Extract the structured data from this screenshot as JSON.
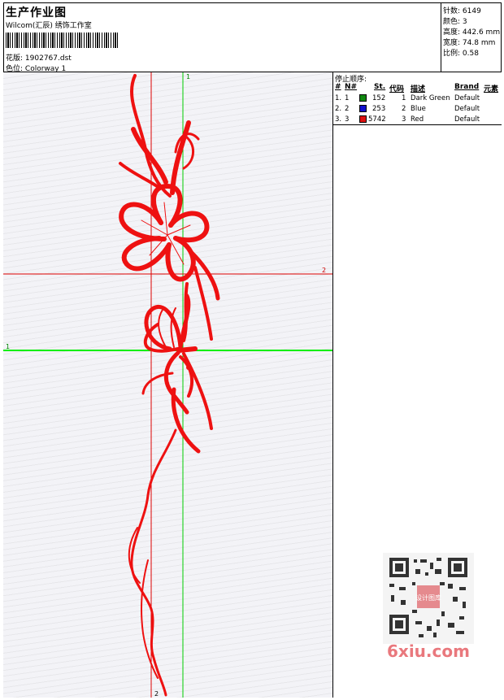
{
  "header": {
    "title": "生产作业图",
    "studio": "Wilcom(汇辰) 绣饰工作室",
    "design_file_label": "花版:",
    "design_file": "1902767.dst",
    "colorway_label": "色位:",
    "colorway": "Colorway 1"
  },
  "stats": {
    "stitches_label": "针数:",
    "stitches": "6149",
    "colors_label": "颜色:",
    "colors": "3",
    "height_label": "高度:",
    "height": "442.6 mm",
    "width_label": "宽度:",
    "width": "74.8 mm",
    "scale_label": "比例:",
    "scale": "0.58"
  },
  "design": {
    "markers": {
      "v_green": "1",
      "v_red": "2",
      "h_red": "2",
      "h_green": "1"
    },
    "thread_color": "#ee1111",
    "guide_green": "#00cc00",
    "guide_red": "#dd0000"
  },
  "stop_sequence": {
    "title": "停止顺序:",
    "headers": {
      "num": "#",
      "needle": "N#",
      "st": "St.",
      "code": "代码",
      "desc": "描述",
      "brand": "Brand",
      "element": "元素"
    },
    "rows": [
      {
        "num": "1.",
        "needle": "1",
        "color": "#118811",
        "st": "152",
        "code": "1",
        "desc": "Dark Green",
        "brand": "Default"
      },
      {
        "num": "2.",
        "needle": "2",
        "color": "#1111cc",
        "st": "253",
        "code": "2",
        "desc": "Blue",
        "brand": "Default"
      },
      {
        "num": "3.",
        "needle": "3",
        "color": "#dd1111",
        "st": "5742",
        "code": "3",
        "desc": "Red",
        "brand": "Default"
      }
    ]
  },
  "watermark": {
    "site": "6xiu.com",
    "seal": "设计图库"
  }
}
